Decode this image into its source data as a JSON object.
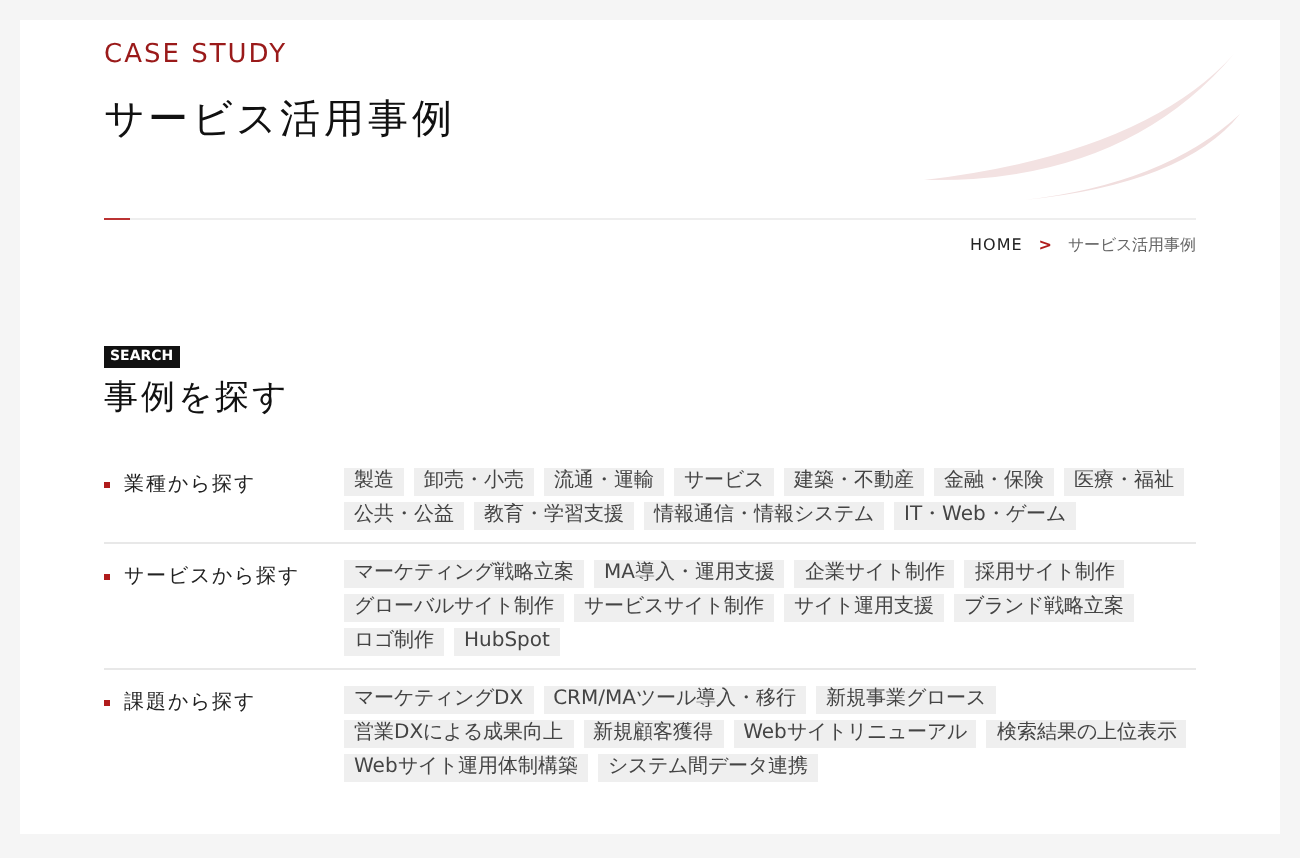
{
  "header": {
    "eyebrow": "CASE STUDY",
    "title": "サービス活用事例"
  },
  "breadcrumb": [
    {
      "label": "HOME",
      "current": false
    },
    {
      "label": "サービス活用事例",
      "current": true
    }
  ],
  "breadcrumb_separator": ">",
  "search": {
    "badge": "SEARCH",
    "title": "事例を探す"
  },
  "groups": [
    {
      "label": "業種から探す",
      "tags": [
        "製造",
        "卸売・小売",
        "流通・運輸",
        "サービス",
        "建築・不動産",
        "金融・保険",
        "医療・福祉",
        "公共・公益",
        "教育・学習支援",
        "情報通信・情報システム",
        "IT・Web・ゲーム"
      ]
    },
    {
      "label": "サービスから探す",
      "tags": [
        "マーケティング戦略立案",
        "MA導入・運用支援",
        "企業サイト制作",
        "採用サイト制作",
        "グローバルサイト制作",
        "サービスサイト制作",
        "サイト運用支援",
        "ブランド戦略立案",
        "ロゴ制作",
        "HubSpot"
      ]
    },
    {
      "label": "課題から探す",
      "tags": [
        "マーケティングDX",
        "CRM/MAツール導入・移行",
        "新規事業グロース",
        "営業DXによる成果向上",
        "新規顧客獲得",
        "Webサイトリニューアル",
        "検索結果の上位表示",
        "Webサイト運用体制構築",
        "システム間データ連携"
      ]
    }
  ]
}
